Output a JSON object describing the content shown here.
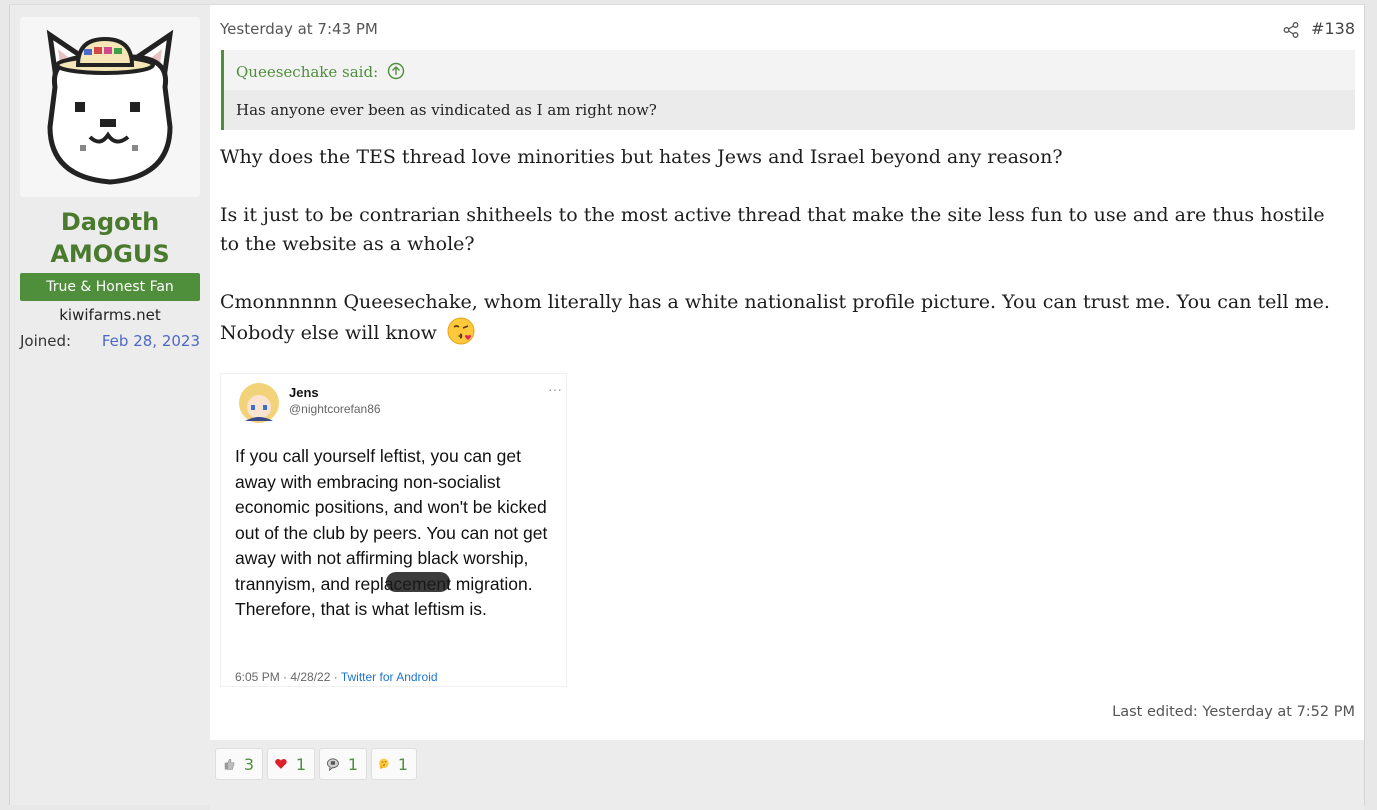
{
  "post": {
    "date": "Yesterday at 7:43 PM",
    "number": "#138",
    "last_edited": "Last edited: Yesterday at 7:52 PM"
  },
  "user": {
    "name_line1": "Dagoth",
    "name_line2": "AMOGUS",
    "title": "True & Honest Fan",
    "banner": "kiwifarms.net",
    "joined_label": "Joined:",
    "joined_date": "Feb 28, 2023"
  },
  "quote": {
    "author": "Queesechake said:",
    "text": "Has anyone ever been as vindicated as I am right now?"
  },
  "body": {
    "p1": "Why does the TES thread love minorities but hates Jews and Israel beyond any reason?",
    "p2": "Is it just to be contrarian shitheels to the most active thread that make the site less fun to use and are thus hostile to the website as a whole?",
    "p3": "Cmonnnnnn Queesechake, whom literally has a white nationalist profile picture. You can trust me. You can tell me. Nobody else will know"
  },
  "tweet": {
    "name": "Jens",
    "handle": "@nightcorefan86",
    "more": "···",
    "text": "If you call yourself leftist, you can get away with embracing non-socialist economic positions, and won't be kicked out of the club by peers. You can not get away with not affirming black worship, trannyism, and replacement migration. Therefore, that is what leftism is.",
    "time": "6:05 PM · 4/28/22 · ",
    "source": "Twitter for Android"
  },
  "reactions": [
    {
      "icon": "thumbs-icon",
      "count": "3"
    },
    {
      "icon": "heart-icon",
      "count": "1"
    },
    {
      "icon": "speech-bubble-icon",
      "count": "1"
    },
    {
      "icon": "thinking-face-icon",
      "count": "1"
    }
  ],
  "colors": {
    "accent_green": "#4f8f3c",
    "username_green": "#4a7a2e",
    "link_blue": "#4d68c4"
  }
}
